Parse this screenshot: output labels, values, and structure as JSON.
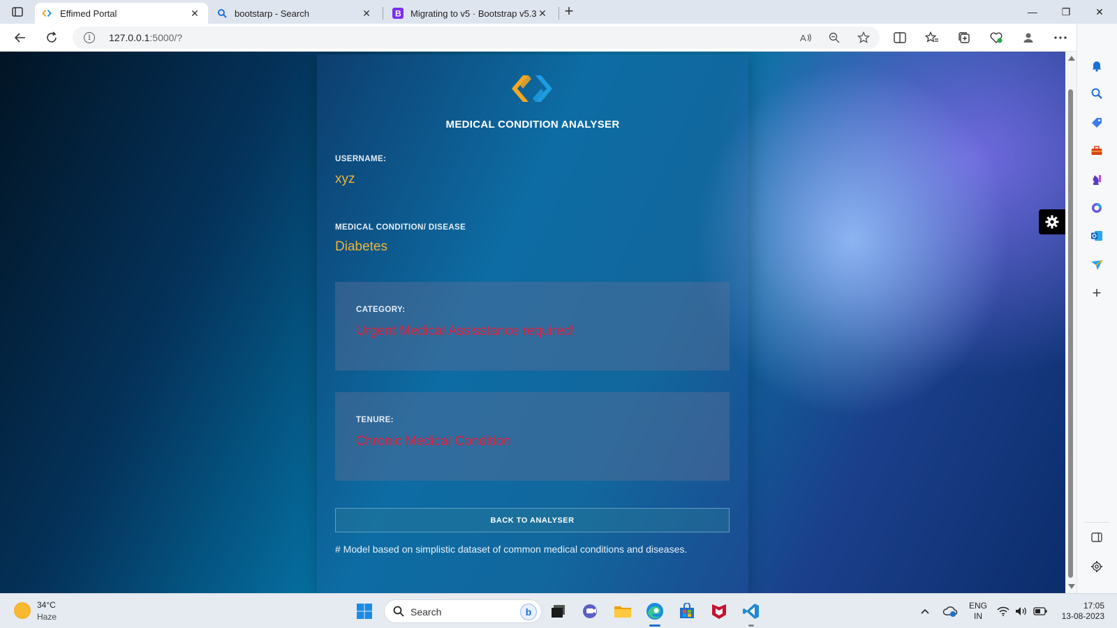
{
  "browser": {
    "tabs": [
      {
        "title": "Effimed Portal",
        "close": "✕"
      },
      {
        "title": "bootstarp - Search",
        "close": "✕"
      },
      {
        "title": "Migrating to v5 · Bootstrap v5.3",
        "close": "✕"
      }
    ],
    "new_tab": "+",
    "window_controls": {
      "minimize": "—",
      "restore": "❐",
      "close": "✕"
    },
    "address": {
      "host": "127.0.0.1",
      "path": ":5000/?"
    },
    "icons": [
      "back-icon",
      "refresh-icon",
      "info-icon",
      "read-aloud-icon",
      "zoom-out-icon",
      "favorite-icon",
      "split-screen-icon",
      "favorites-icon",
      "collections-icon",
      "browser-essentials-icon",
      "profile-icon",
      "more-icon",
      "bing-copilot-icon"
    ]
  },
  "page": {
    "app_title": "MEDICAL CONDITION ANALYSER",
    "username_label": "USERNAME:",
    "username_value": "xyz",
    "condition_label": "MEDICAL CONDITION/ DISEASE",
    "condition_value": "Diabetes",
    "category_label": "CATEGORY:",
    "category_value": "Urgent Medical Assisstance required!",
    "tenure_label": "TENURE:",
    "tenure_value": "Chronic Medical Condition",
    "back_button": "BACK TO ANALYSER",
    "note": "# Model based on simplistic dataset of common medical conditions and diseases.",
    "colors": {
      "value_yellow": "#f0b43a",
      "value_red": "#e0203a",
      "logo_orange": "#f5a623",
      "logo_blue": "#1f9be0"
    }
  },
  "sidebar": {
    "icons": [
      "bell-icon",
      "search-icon",
      "shopping-icon",
      "tools-icon",
      "games-icon",
      "microsoft365-icon",
      "outlook-icon",
      "drop-icon",
      "add-icon",
      "sidebar-toggle-icon",
      "settings-icon"
    ],
    "add": "+"
  },
  "taskbar": {
    "weather_temp": "34°C",
    "weather_condition": "Haze",
    "search_placeholder": "Search",
    "lang_primary": "ENG",
    "lang_region": "IN",
    "time": "17:05",
    "date": "13-08-2023",
    "apps": [
      "start-icon",
      "task-view-icon",
      "teams-icon",
      "file-explorer-icon",
      "edge-icon",
      "store-icon",
      "mcafee-icon",
      "vscode-icon"
    ]
  }
}
